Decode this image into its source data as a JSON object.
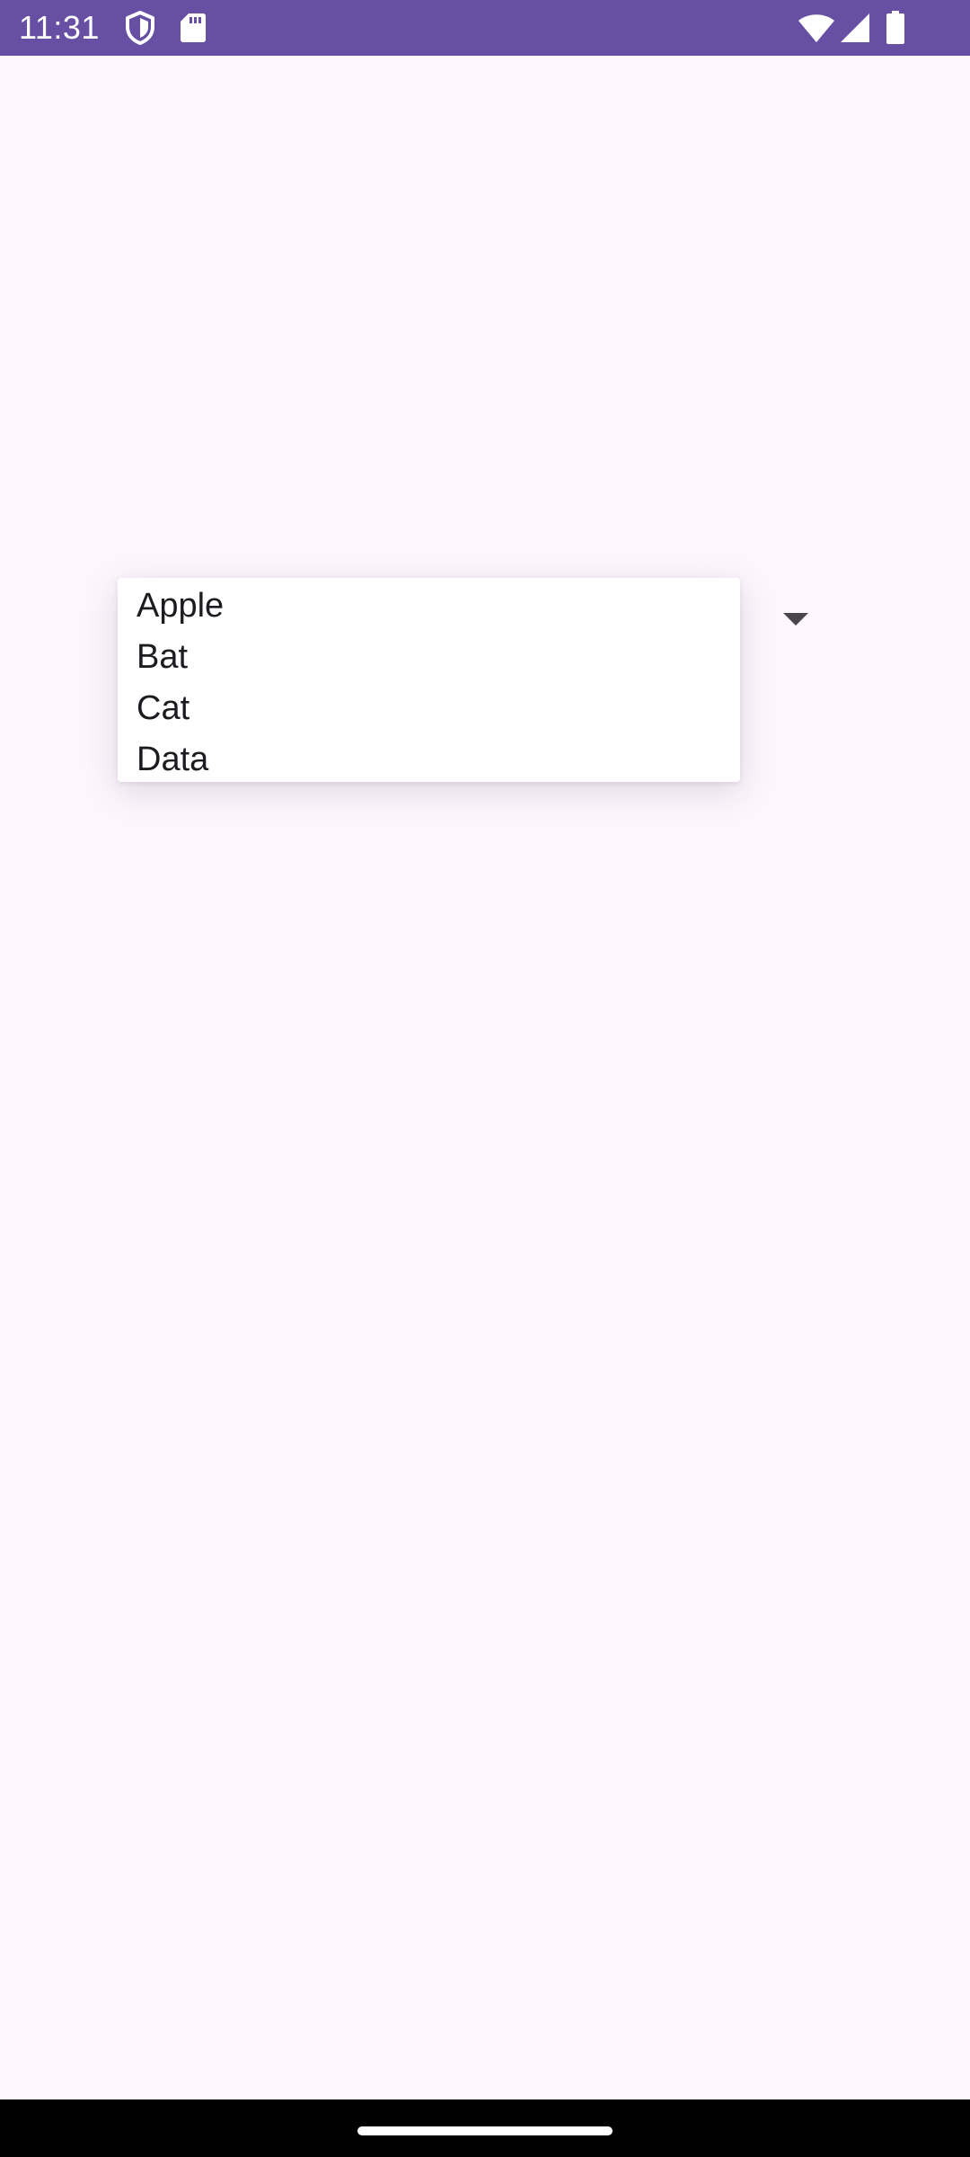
{
  "colors": {
    "status_bar_bg": "#6750a4",
    "screen_bg": "#fdf7fd",
    "nav_bar_bg": "#000000",
    "nav_handle": "#ffffff",
    "status_icon": "#ffffff",
    "arrow": "#49454f"
  },
  "status_bar": {
    "time": "11:31",
    "left_icons": [
      "vpn-shield-icon",
      "sd-card-icon"
    ],
    "right_icons": [
      "wifi-icon",
      "cell-signal-icon",
      "battery-icon"
    ]
  },
  "spinner": {
    "arrow_icon": "arrow-drop-down-icon",
    "expanded": true,
    "options": [
      "Apple",
      "Bat",
      "Cat",
      "Data"
    ]
  }
}
